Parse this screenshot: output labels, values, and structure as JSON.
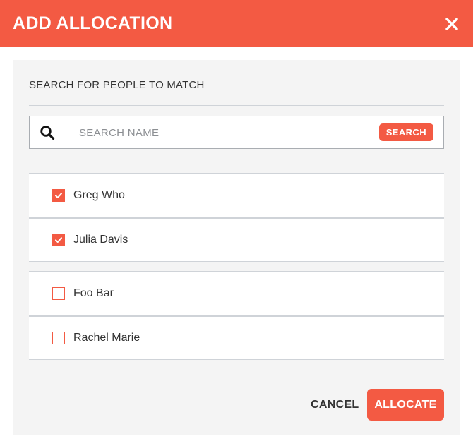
{
  "dialog": {
    "title": "ADD ALLOCATION",
    "close_icon": "close-icon"
  },
  "search": {
    "section_label": "SEARCH FOR PEOPLE TO MATCH",
    "placeholder": "SEARCH NAME",
    "value": "",
    "button_label": "SEARCH",
    "icon": "search-icon"
  },
  "selected_people": [
    {
      "name": "Greg Who",
      "checked": true
    },
    {
      "name": "Julia Davis",
      "checked": true
    }
  ],
  "available_people": [
    {
      "name": "Foo Bar",
      "checked": false
    },
    {
      "name": "Rachel Marie",
      "checked": false
    }
  ],
  "actions": {
    "cancel_label": "CANCEL",
    "allocate_label": "ALLOCATE"
  },
  "colors": {
    "accent": "#f35a43",
    "panel_background": "#f4f4f4",
    "divider": "#cfd3d8"
  }
}
